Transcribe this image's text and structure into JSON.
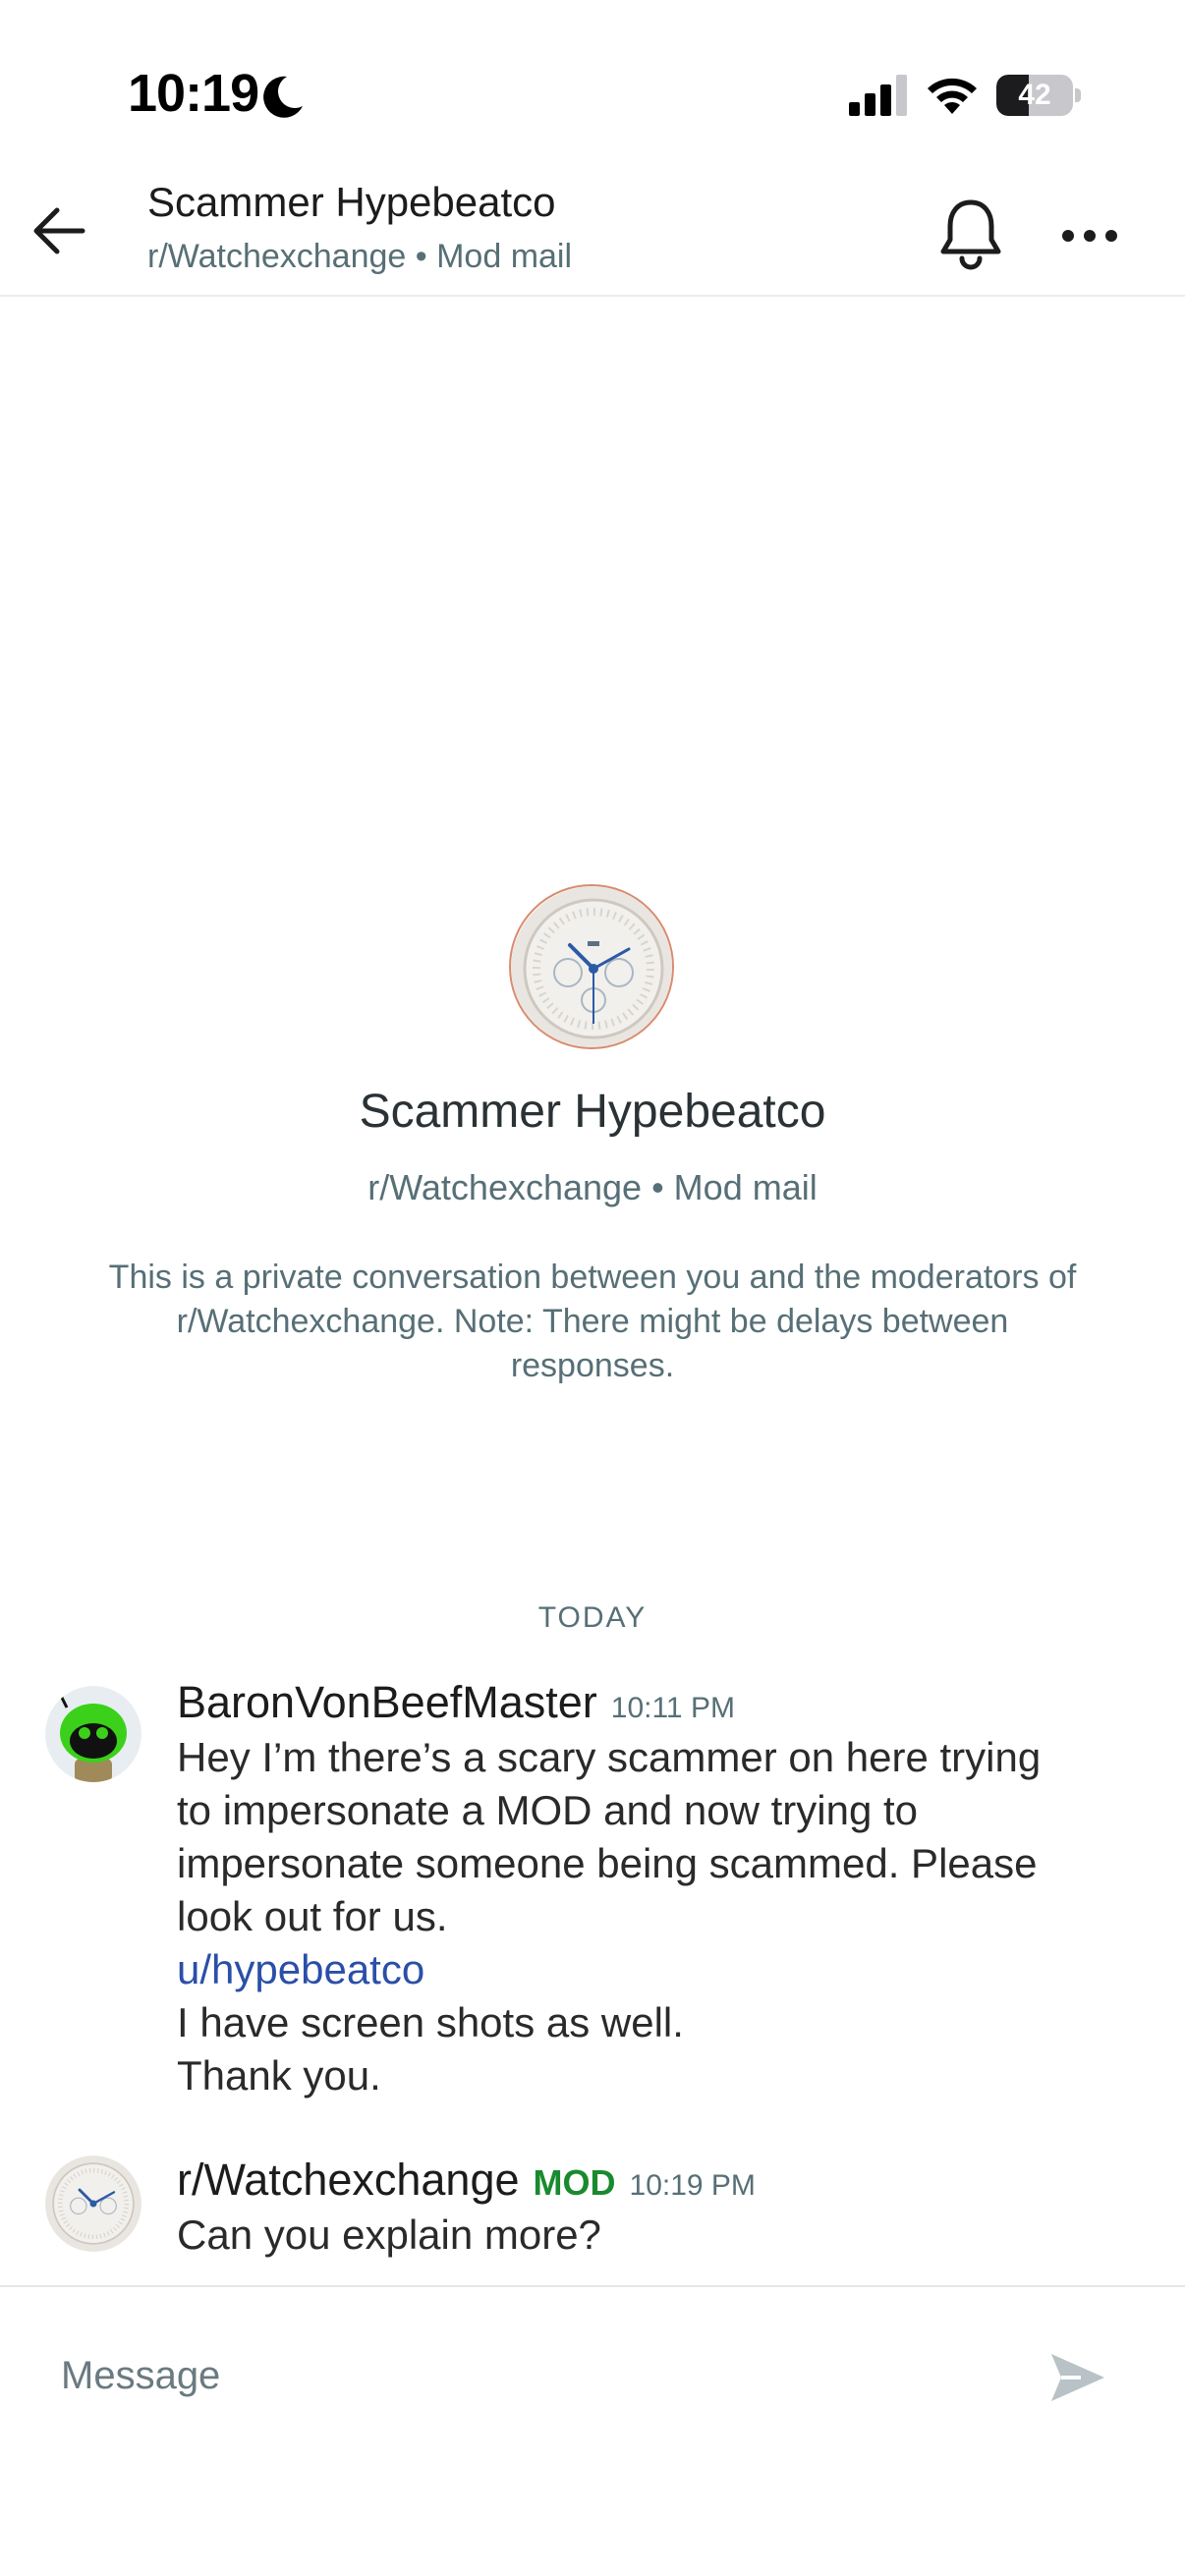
{
  "status_bar": {
    "time": "10:19",
    "battery": "42",
    "battery_level": 0.42
  },
  "header": {
    "title": "Scammer Hypebeatco",
    "subtitle": "r/Watchexchange • Mod mail"
  },
  "intro": {
    "name": "Scammer Hypebeatco",
    "subtitle": "r/Watchexchange • Mod mail",
    "note": "This is a private conversation between you and the moderators of r/Watchexchange. Note: There might be delays between responses."
  },
  "day_separator": "TODAY",
  "messages": [
    {
      "author": "BaronVonBeefMaster",
      "time": "10:11 PM",
      "lines": [
        "Hey I’m there’s a scary scammer on here trying",
        "to impersonate a MOD and now trying to",
        "impersonate someone being scammed. Please",
        "look out for us."
      ],
      "link": "u/hypebeatco",
      "after_lines": [
        "I have screen shots as well.",
        "Thank you."
      ]
    },
    {
      "author": "r/Watchexchange",
      "badge": "MOD",
      "time": "10:19 PM",
      "lines": [
        "Can you explain more?"
      ]
    }
  ],
  "composer": {
    "placeholder": "Message"
  },
  "colors": {
    "mod_badge": "#1a8a2e",
    "link": "#2b4fa8",
    "muted_text": "#576f76",
    "user_avatar": "#3bd11a"
  },
  "icons": [
    "moon-icon",
    "signal-icon",
    "wifi-icon",
    "battery-icon",
    "back-arrow-icon",
    "bell-icon",
    "more-icon",
    "send-icon"
  ]
}
